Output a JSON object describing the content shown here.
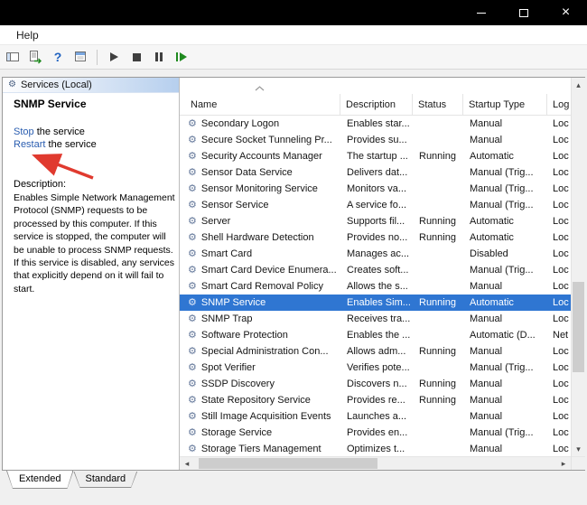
{
  "colors": {
    "titlebar_bg": "#000000",
    "selection_bg": "#2f76d2",
    "selection_text": "#ffffff",
    "link": "#2a5db0",
    "arrow": "#e03a2f"
  },
  "titlebar": {
    "close_glyph": "×"
  },
  "menubar": {
    "items": [
      "Help"
    ]
  },
  "icons": {
    "gear_glyph": "⚙",
    "header_gear_glyph": "⚙",
    "help_glyph": "?",
    "scroll_up": "▴",
    "scroll_down": "▾",
    "scroll_left": "◂",
    "scroll_right": "▸"
  },
  "left_panel": {
    "header_title": "Services (Local)",
    "service_title": "SNMP Service",
    "stop_link": "Stop",
    "stop_suffix": " the service",
    "restart_link": "Restart",
    "restart_suffix": " the service",
    "description_heading": "Description:",
    "description_text": "Enables Simple Network Management Protocol (SNMP) requests to be processed by this computer. If this service is stopped, the computer will be unable to process SNMP requests. If this service is disabled, any services that explicitly depend on it will fail to start."
  },
  "services_list": {
    "columns": [
      "Name",
      "Description",
      "Status",
      "Startup Type",
      "Log"
    ],
    "selected_service": "SNMP Service",
    "rows": [
      {
        "name": "Secondary Logon",
        "description": "Enables star...",
        "status": "",
        "startup_type": "Manual",
        "log_on_as": "Loc"
      },
      {
        "name": "Secure Socket Tunneling Pr...",
        "description": "Provides su...",
        "status": "",
        "startup_type": "Manual",
        "log_on_as": "Loc"
      },
      {
        "name": "Security Accounts Manager",
        "description": "The startup ...",
        "status": "Running",
        "startup_type": "Automatic",
        "log_on_as": "Loc"
      },
      {
        "name": "Sensor Data Service",
        "description": "Delivers dat...",
        "status": "",
        "startup_type": "Manual (Trig...",
        "log_on_as": "Loc"
      },
      {
        "name": "Sensor Monitoring Service",
        "description": "Monitors va...",
        "status": "",
        "startup_type": "Manual (Trig...",
        "log_on_as": "Loc"
      },
      {
        "name": "Sensor Service",
        "description": "A service fo...",
        "status": "",
        "startup_type": "Manual (Trig...",
        "log_on_as": "Loc"
      },
      {
        "name": "Server",
        "description": "Supports fil...",
        "status": "Running",
        "startup_type": "Automatic",
        "log_on_as": "Loc"
      },
      {
        "name": "Shell Hardware Detection",
        "description": "Provides no...",
        "status": "Running",
        "startup_type": "Automatic",
        "log_on_as": "Loc"
      },
      {
        "name": "Smart Card",
        "description": "Manages ac...",
        "status": "",
        "startup_type": "Disabled",
        "log_on_as": "Loc"
      },
      {
        "name": "Smart Card Device Enumera...",
        "description": "Creates soft...",
        "status": "",
        "startup_type": "Manual (Trig...",
        "log_on_as": "Loc"
      },
      {
        "name": "Smart Card Removal Policy",
        "description": "Allows the s...",
        "status": "",
        "startup_type": "Manual",
        "log_on_as": "Loc"
      },
      {
        "name": "SNMP Service",
        "description": "Enables Sim...",
        "status": "Running",
        "startup_type": "Automatic",
        "log_on_as": "Loc"
      },
      {
        "name": "SNMP Trap",
        "description": "Receives tra...",
        "status": "",
        "startup_type": "Manual",
        "log_on_as": "Loc"
      },
      {
        "name": "Software Protection",
        "description": "Enables the ...",
        "status": "",
        "startup_type": "Automatic (D...",
        "log_on_as": "Net"
      },
      {
        "name": "Special Administration Con...",
        "description": "Allows adm...",
        "status": "Running",
        "startup_type": "Manual",
        "log_on_as": "Loc"
      },
      {
        "name": "Spot Verifier",
        "description": "Verifies pote...",
        "status": "",
        "startup_type": "Manual (Trig...",
        "log_on_as": "Loc"
      },
      {
        "name": "SSDP Discovery",
        "description": "Discovers n...",
        "status": "Running",
        "startup_type": "Manual",
        "log_on_as": "Loc"
      },
      {
        "name": "State Repository Service",
        "description": "Provides re...",
        "status": "Running",
        "startup_type": "Manual",
        "log_on_as": "Loc"
      },
      {
        "name": "Still Image Acquisition Events",
        "description": "Launches a...",
        "status": "",
        "startup_type": "Manual",
        "log_on_as": "Loc"
      },
      {
        "name": "Storage Service",
        "description": "Provides en...",
        "status": "",
        "startup_type": "Manual (Trig...",
        "log_on_as": "Loc"
      },
      {
        "name": "Storage Tiers Management",
        "description": "Optimizes t...",
        "status": "",
        "startup_type": "Manual",
        "log_on_as": "Loc"
      }
    ]
  },
  "tabs": [
    "Extended",
    "Standard"
  ],
  "active_tab": "Extended"
}
